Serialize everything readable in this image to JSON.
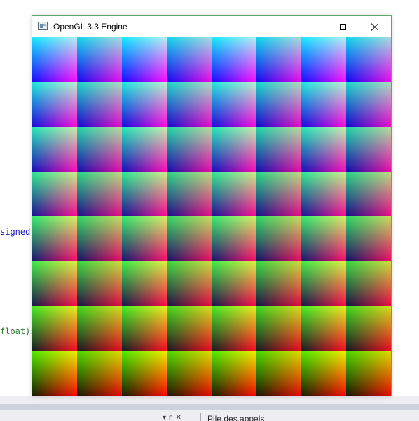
{
  "window": {
    "title": "OpenGL 3.3 Engine",
    "controls": {
      "minimize_icon": "minimize-icon",
      "maximize_icon": "maximize-icon",
      "close_icon": "close-icon"
    }
  },
  "render": {
    "grid_rows": 8,
    "grid_cols": 8,
    "tile_content": "RGB gradient quads"
  },
  "background_code": {
    "fragment_1": "signed",
    "fragment_1_color": "#1a1ad6",
    "fragment_2": "float)s",
    "fragment_2_color": "#2e7d32"
  },
  "bottom_panel": {
    "dropdown_glyph": "▾",
    "pin_glyph": "ᴨ",
    "close_glyph": "✕",
    "tab_label": "Pile des appels"
  }
}
